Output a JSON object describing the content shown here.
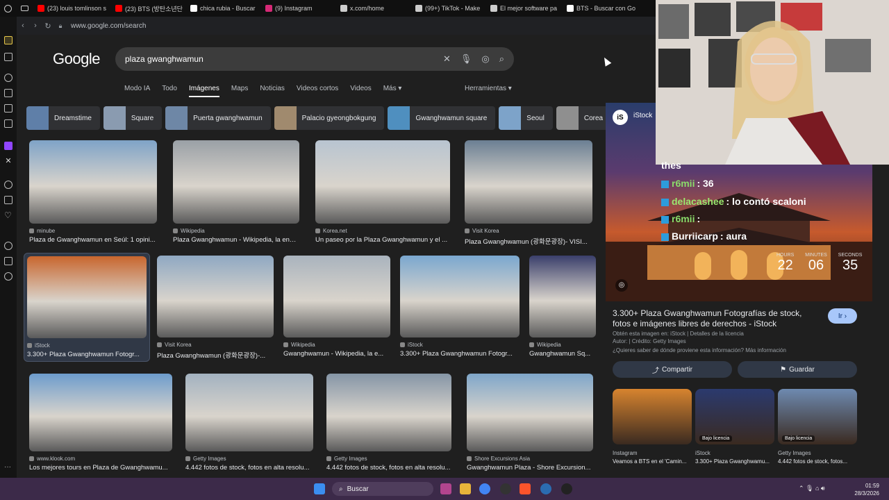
{
  "tabs": [
    {
      "title": "(23) louis tomlinson s",
      "color": "#ff0000"
    },
    {
      "title": "(23) BTS (방탄소년단",
      "color": "#ff0000"
    },
    {
      "title": "chica rubia - Buscar",
      "color": "#ffffff"
    },
    {
      "title": "(9) Instagram",
      "color": "#d62976"
    },
    {
      "title": "x.com/home",
      "color": "#cccccc"
    },
    {
      "title": "(99+) TikTok - Make",
      "color": "#cccccc"
    },
    {
      "title": "El mejor software pa",
      "color": "#cccccc"
    },
    {
      "title": "BTS - Buscar con Go",
      "color": "#ffffff"
    }
  ],
  "address": {
    "url": "www.google.com/search"
  },
  "google": {
    "logo": "Google",
    "query": "plaza gwanghwamun",
    "nav": [
      "Modo IA",
      "Todo",
      "Imágenes",
      "Maps",
      "Noticias",
      "Videos cortos",
      "Videos",
      "Más ▾"
    ],
    "active_nav": "Imágenes",
    "tools": "Herramientas ▾",
    "chips": [
      "Dreamstime",
      "Square",
      "Puerta gwanghwamun",
      "Palacio gyeongbokgung",
      "Gwanghwamun square",
      "Seoul",
      "Corea"
    ],
    "row1": [
      {
        "source": "minube",
        "caption": "Plaza de Gwanghwamun en Seúl: 1 opini..."
      },
      {
        "source": "Wikipedia",
        "caption": "Plaza Gwanghwamun - Wikipedia, la enci..."
      },
      {
        "source": "Korea.net",
        "caption": "Un paseo por la Plaza Gwanghwamun y el ..."
      },
      {
        "source": "Visit Korea",
        "caption": "Plaza Gwanghwamun (광화문광장)- VISI..."
      }
    ],
    "row2": [
      {
        "source": "iStock",
        "caption": "3.300+ Plaza Gwanghwamun Fotogr..."
      },
      {
        "source": "Visit Korea",
        "caption": "Plaza Gwanghwamun (광화문광장)-..."
      },
      {
        "source": "Wikipedia",
        "caption": "Gwanghwamun - Wikipedia, la e..."
      },
      {
        "source": "iStock",
        "caption": "3.300+ Plaza Gwanghwamun Fotogr..."
      },
      {
        "source": "Wikipedia",
        "caption": "Gwanghwamun Sq..."
      }
    ],
    "row3": [
      {
        "source": "www.klook.com",
        "caption": "Los mejores tours en Plaza de Gwanghwamu..."
      },
      {
        "source": "Getty Images",
        "caption": "4.442 fotos de stock, fotos en alta resolu..."
      },
      {
        "source": "Getty Images",
        "caption": "4.442 fotos de stock, fotos en alta resolu..."
      },
      {
        "source": "Shore Excursions Asia",
        "caption": "Gwanghwamun Plaza - Shore Excursion..."
      }
    ]
  },
  "panel": {
    "site": "iStock",
    "title": "3.300+ Plaza Gwanghwamun Fotografías de stock, fotos e imágenes libres de derechos - iStock",
    "go": "Ir ›",
    "obtain": "Obtén esta imagen en: iStock | Detalles de la licencia",
    "author": "Autor: | Crédito: Getty Images",
    "question": "¿Quieres saber de dónde proviene esta información? Más información",
    "share": "Compartir",
    "save": "Guardar",
    "related": [
      {
        "source": "Instagram",
        "caption": "Veamos a BTS en el 'Camin...",
        "badge": ""
      },
      {
        "source": "iStock",
        "caption": "3.300+ Plaza Gwanghwamu...",
        "badge": "Bajo licencia"
      },
      {
        "source": "Getty Images",
        "caption": "4.442 fotos de stock, fotos...",
        "badge": "Bajo licencia"
      }
    ]
  },
  "chat": [
    {
      "user": "thes",
      "msg": ""
    },
    {
      "user": "r6mii",
      "msg": ": 36"
    },
    {
      "user": "delacashee",
      "msg": ": lo contó scaloni"
    },
    {
      "user": "r6mii",
      "msg": ":"
    },
    {
      "user": "Burriicarp",
      "msg": ": aura"
    }
  ],
  "timer": {
    "hours_label": "HOURS",
    "hours": "22",
    "minutes_label": "MINUTES",
    "minutes": "06",
    "seconds_label": "SECONDS",
    "seconds": "35"
  },
  "taskbar": {
    "search": "Buscar",
    "time": "01:59",
    "date": "28/3/2026"
  }
}
